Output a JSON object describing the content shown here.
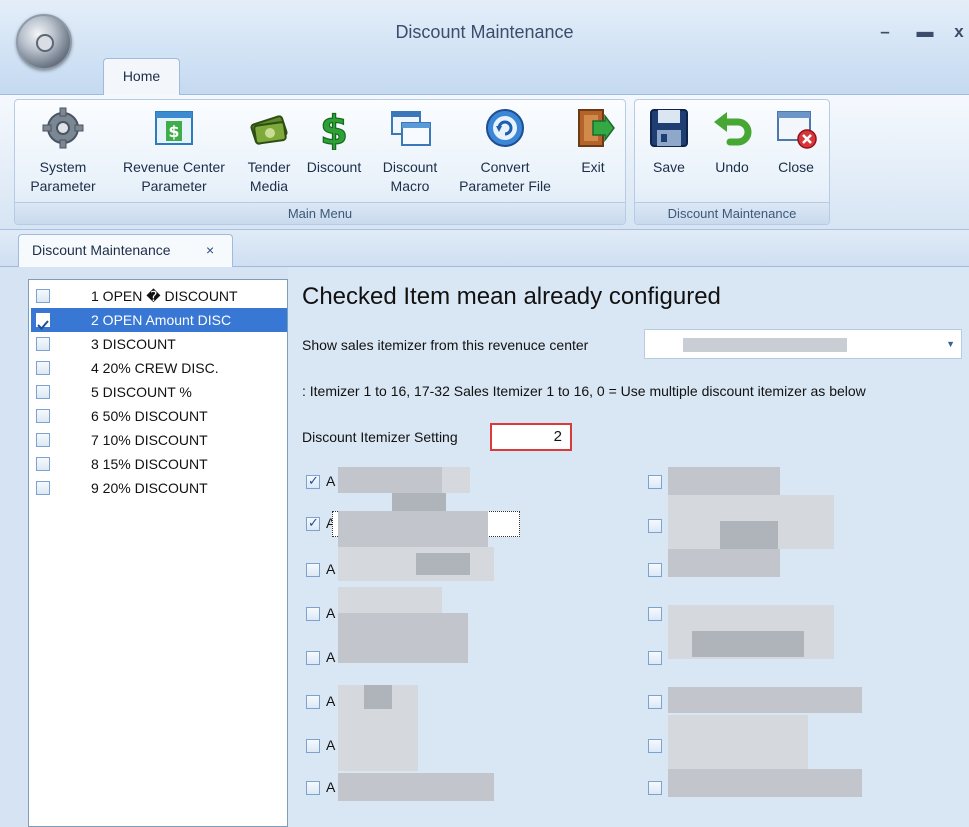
{
  "window": {
    "title": "Discount Maintenance",
    "minimize_glyph": "–",
    "maximize_glyph": "▬",
    "close_glyph": "x",
    "app_icon": "gear-icon"
  },
  "ribbon": {
    "home_tab": "Home",
    "main_group_label": "Main Menu",
    "disc_group_label": "Discount Maintenance",
    "buttons": [
      {
        "label": "System\nParameter",
        "icon": "gear-icon"
      },
      {
        "label": "Revenue Center\nParameter",
        "icon": "revenue-sheet-icon"
      },
      {
        "label": "Tender\nMedia",
        "icon": "money-stack-icon"
      },
      {
        "label": "Discount",
        "icon": "dollar-icon"
      },
      {
        "label": "Discount\nMacro",
        "icon": "windows-icon"
      },
      {
        "label": "Convert\nParameter File",
        "icon": "convert-icon"
      },
      {
        "label": "Exit",
        "icon": "exit-door-icon"
      },
      {
        "label": "Save",
        "icon": "floppy-icon"
      },
      {
        "label": "Undo",
        "icon": "undo-arrow-icon"
      },
      {
        "label": "Close",
        "icon": "close-window-icon"
      }
    ]
  },
  "doc_tab": {
    "label": "Discount Maintenance",
    "close": "×"
  },
  "list": {
    "items": [
      {
        "label": "1 OPEN � DISCOUNT",
        "checked": false,
        "selected": false
      },
      {
        "label": "2 OPEN Amount DISC",
        "checked": true,
        "selected": true
      },
      {
        "label": "3 DISCOUNT",
        "checked": false,
        "selected": false
      },
      {
        "label": "4 20% CREW DISC.",
        "checked": false,
        "selected": false
      },
      {
        "label": "5 DISCOUNT %",
        "checked": false,
        "selected": false
      },
      {
        "label": "6 50% DISCOUNT",
        "checked": false,
        "selected": false
      },
      {
        "label": "7 10% DISCOUNT",
        "checked": false,
        "selected": false
      },
      {
        "label": "8 15% DISCOUNT",
        "checked": false,
        "selected": false
      },
      {
        "label": "9 20% DISCOUNT",
        "checked": false,
        "selected": false
      }
    ]
  },
  "detail": {
    "heading": "Checked Item mean already configured",
    "revenue_center_label": "Show sales itemizer from this revenuce center",
    "revenue_center_value": "",
    "itemizer_note": ": Itemizer 1 to 16, 17-32 Sales Itemizer 1 to 16, 0 = Use multiple discount itemizer as below",
    "itemizer_setting_label": "Discount Itemizer Setting",
    "itemizer_setting_value": "2",
    "item_prefix": "A",
    "left_items_checked": [
      true,
      true,
      false,
      false,
      false,
      false,
      false,
      false
    ],
    "right_items_checked": [
      false,
      false,
      false,
      false,
      false,
      false,
      false,
      false
    ]
  },
  "colors": {
    "selection": "#3877d4",
    "highlight_border": "#d93a3a",
    "panel_bg": "#d9e6f4"
  }
}
